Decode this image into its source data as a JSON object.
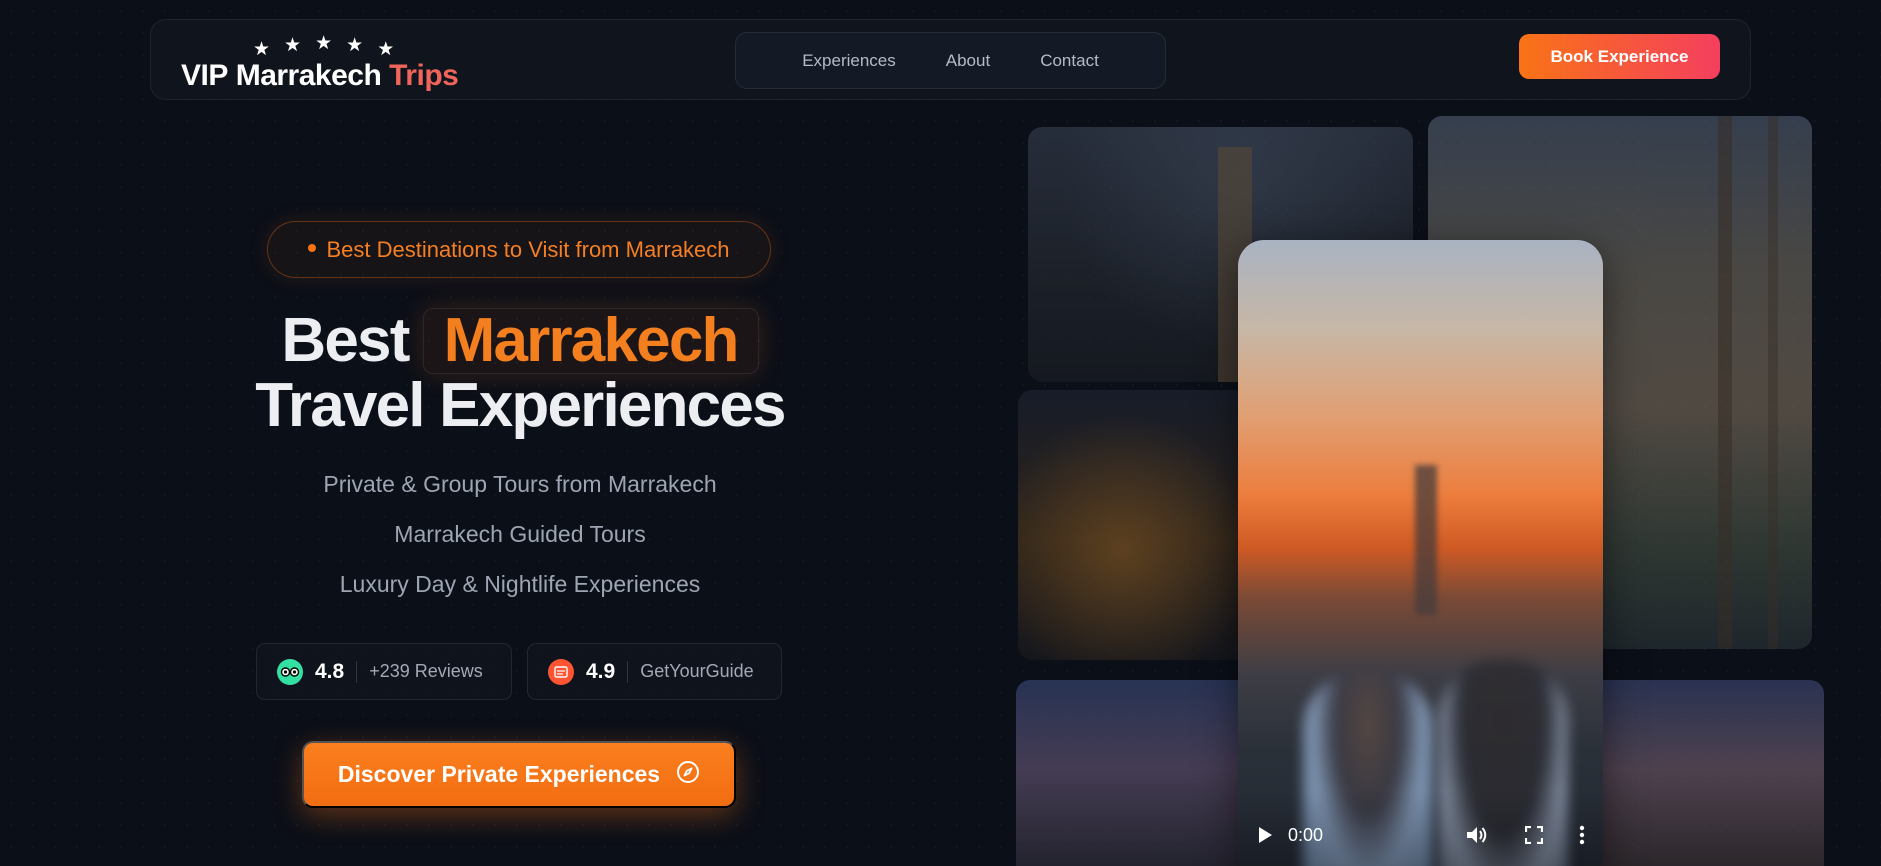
{
  "brand": {
    "vip": "VIP",
    "name": "Marrakech",
    "accent": "Trips",
    "stars": [
      "★",
      "★",
      "★",
      "★",
      "★"
    ]
  },
  "nav": {
    "links": [
      "Experiences",
      "About",
      "Contact"
    ],
    "book_label": "Book Experience"
  },
  "hero": {
    "pill": "Best Destinations to Visit from Marrakech",
    "headline_word1": "Best",
    "headline_highlight": "Marrakech",
    "headline_line2": "Travel Experiences",
    "subs": [
      "Private & Group Tours from Marrakech",
      "Marrakech Guided Tours",
      "Luxury Day & Nightlife Experiences"
    ],
    "ratings": [
      {
        "icon": "tripadvisor-icon",
        "score": "4.8",
        "label": "+239 Reviews"
      },
      {
        "icon": "getyourguide-icon",
        "score": "4.9",
        "label": "GetYourGuide"
      }
    ],
    "cta_label": "Discover Private Experiences"
  },
  "video": {
    "time": "0:00",
    "progress": 0.04
  },
  "colors": {
    "accent_orange": "#f97316",
    "accent_pink": "#f43f5e",
    "background": "#0b0f18"
  }
}
